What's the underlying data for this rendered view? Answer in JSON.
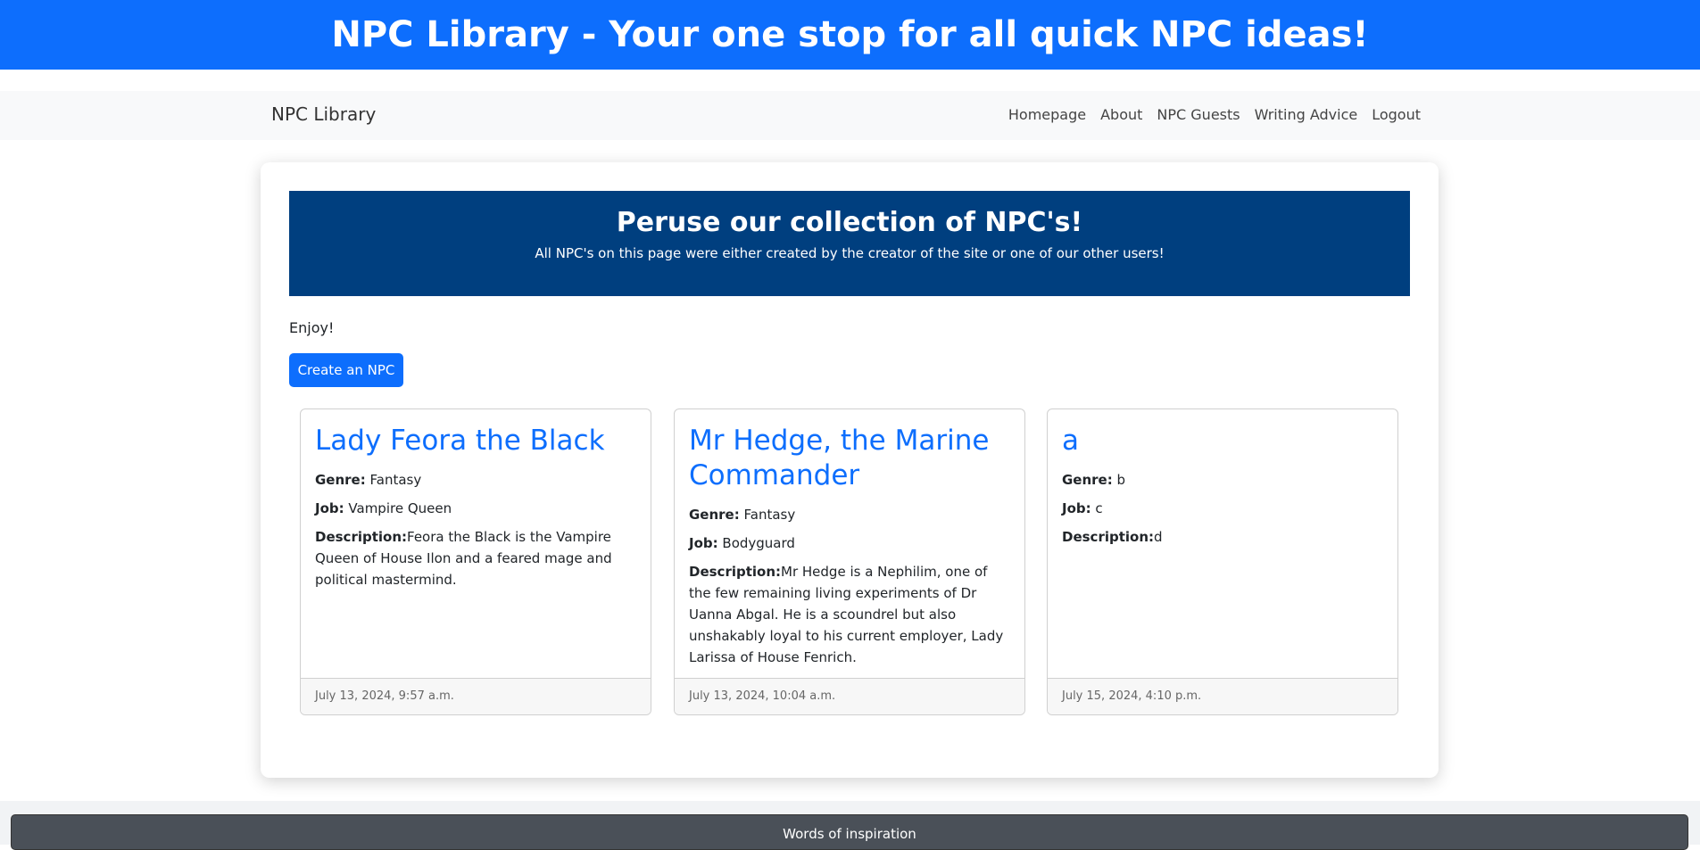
{
  "banner": {
    "title": "NPC Library - Your one stop for all quick NPC ideas!"
  },
  "navbar": {
    "brand": "NPC Library",
    "links": [
      "Homepage",
      "About",
      "NPC Guests",
      "Writing Advice",
      "Logout"
    ]
  },
  "hero": {
    "title": "Peruse our collection of NPC's!",
    "subtitle": "All NPC's on this page were either created by the creator of the site or one of our other users!"
  },
  "intro": {
    "text": "Enjoy!"
  },
  "actions": {
    "create_label": "Create an NPC"
  },
  "labels": {
    "genre": "Genre:",
    "job": "Job:",
    "description": "Description:"
  },
  "npcs": [
    {
      "name": "Lady Feora the Black",
      "genre": "Fantasy",
      "job": "Vampire Queen",
      "description": "Feora the Black is the Vampire Queen of House Ilon and a feared mage and political mastermind.",
      "date": "July 13, 2024, 9:57 a.m."
    },
    {
      "name": "Mr Hedge, the Marine Commander",
      "genre": "Fantasy",
      "job": "Bodyguard",
      "description": "Mr Hedge is a Nephilim, one of the few remaining living experiments of Dr Uanna Abgal. He is a scoundrel but also unshakably loyal to his current employer, Lady Larissa of House Fenrich.",
      "date": "July 13, 2024, 10:04 a.m."
    },
    {
      "name": "a",
      "genre": "b",
      "job": "c",
      "description": "d",
      "date": "July 15, 2024, 4:10 p.m."
    }
  ],
  "footer": {
    "inspiration_label": "Words of inspiration"
  }
}
